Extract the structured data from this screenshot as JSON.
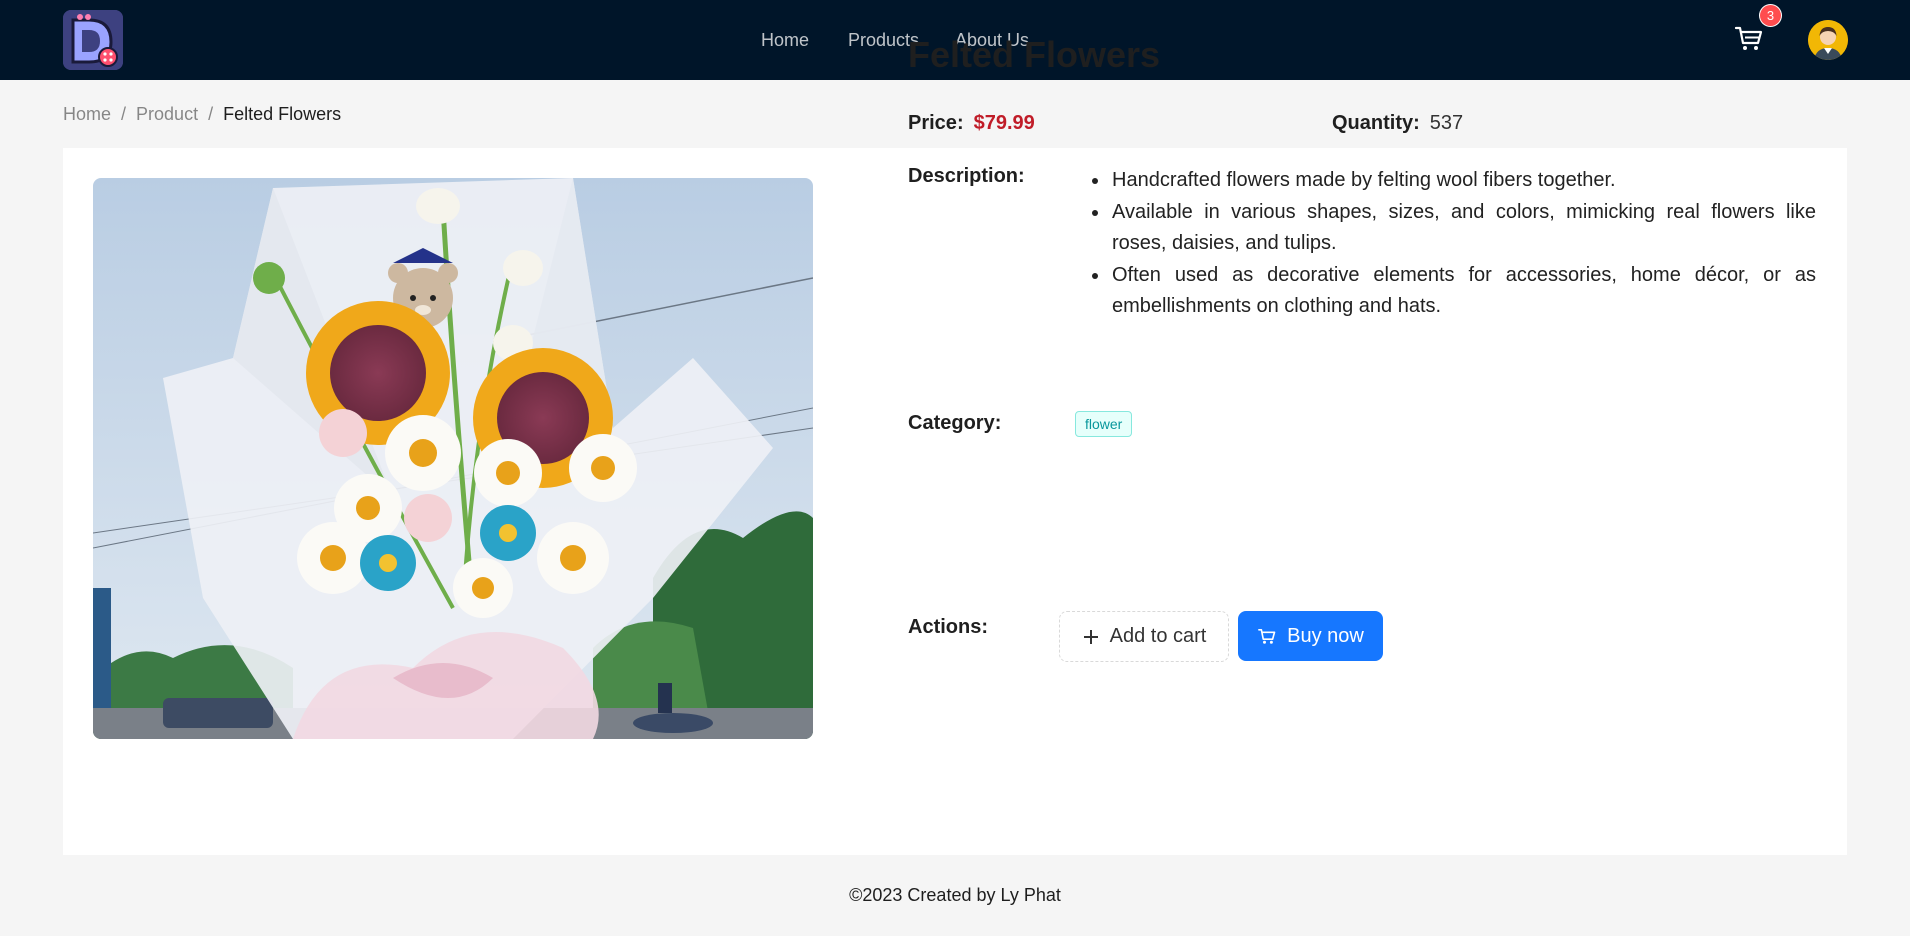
{
  "header": {
    "logo_alt": "D logo",
    "nav": [
      {
        "label": "Home"
      },
      {
        "label": "Products"
      },
      {
        "label": "About Us"
      }
    ],
    "cart_count": "3",
    "cart_icon": "shopping-cart-icon",
    "avatar_icon": "user-avatar-icon"
  },
  "breadcrumb": {
    "items": [
      "Home",
      "Product"
    ],
    "separator": "/",
    "current": "Felted Flowers"
  },
  "product": {
    "title": "Felted Flowers",
    "image_alt": "Crocheted flower bouquet with sunflowers, daisies and a bear",
    "price_label": "Price",
    "price": "$79.99",
    "quantity_label": "Quantity",
    "quantity": "537",
    "description_label": "Description",
    "description": [
      "Handcrafted flowers made by felting wool fibers together.",
      "Available in various shapes, sizes, and colors, mimicking real flowers like roses, daisies, and tulips.",
      "Often used as decorative elements for accessories, home décor, or as embellishments on clothing and hats."
    ],
    "category_label": "Category",
    "category": "flower",
    "actions_label": "Actions",
    "add_to_cart_label": "Add to cart",
    "buy_now_label": "Buy now"
  },
  "footer": {
    "text": "©2023 Created by Ly Phat"
  },
  "colors": {
    "header_bg": "#001529",
    "price": "#c01c28",
    "primary": "#1677ff",
    "badge": "#ff4d4f",
    "tag_bg": "#e6fffb",
    "tag_text": "#08979c"
  }
}
